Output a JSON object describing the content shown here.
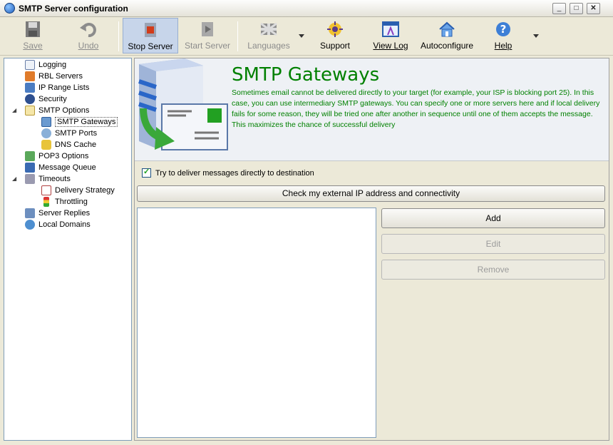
{
  "window": {
    "title": "SMTP Server configuration",
    "min": "_",
    "max": "□",
    "close": "✕"
  },
  "toolbar": {
    "save": "Save",
    "undo": "Undo",
    "stop_server": "Stop Server",
    "start_server": "Start Server",
    "languages": "Languages",
    "support": "Support",
    "view_log": "View Log",
    "autoconfigure": "Autoconfigure",
    "help": "Help"
  },
  "sidebar": {
    "items": [
      {
        "label": "Logging"
      },
      {
        "label": "RBL Servers"
      },
      {
        "label": "IP Range Lists"
      },
      {
        "label": "Security"
      },
      {
        "label": "SMTP Options"
      },
      {
        "label": "SMTP Gateways"
      },
      {
        "label": "SMTP Ports"
      },
      {
        "label": "DNS Cache"
      },
      {
        "label": "POP3 Options"
      },
      {
        "label": "Message Queue"
      },
      {
        "label": "Timeouts"
      },
      {
        "label": "Delivery Strategy"
      },
      {
        "label": "Throttling"
      },
      {
        "label": "Server Replies"
      },
      {
        "label": "Local Domains"
      }
    ]
  },
  "main": {
    "title": "SMTP Gateways",
    "description": "Sometimes email cannot be delivered directly to your target (for example, your ISP is blocking port 25). In this case, you can use intermediary SMTP gateways. You can specify one or more servers here and if local delivery fails for some reason, they will be tried one after another in sequence until one of them accepts the message. This maximizes the chance of successful delivery",
    "direct_delivery_label": "Try to deliver messages directly to destination",
    "direct_delivery_checked": true,
    "check_ip_button": "Check my external IP address and connectivity",
    "add_button": "Add",
    "edit_button": "Edit",
    "remove_button": "Remove"
  },
  "colors": {
    "accent_green": "#008000",
    "selection": "#c7d5ea"
  }
}
